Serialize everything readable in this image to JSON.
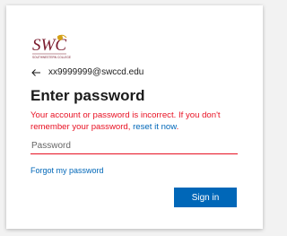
{
  "logo": {
    "name": "swc-logo",
    "text": "SWC",
    "subtext": "SOUTHWESTERN COLLEGE",
    "colors": {
      "primary": "#7b1c2e",
      "accent": "#d4a017"
    }
  },
  "identity": {
    "email": "xx9999999@swccd.edu",
    "back_icon": "arrow-left-icon"
  },
  "heading": "Enter password",
  "error": {
    "message": "Your account or password is incorrect. If you don't remember your password, ",
    "link": "reset it now",
    "suffix": "."
  },
  "password_field": {
    "placeholder": "Password",
    "value": ""
  },
  "forgot_link": "Forgot my password",
  "signin_button": "Sign in",
  "colors": {
    "error": "#e81123",
    "link": "#0067b8",
    "button_bg": "#0067b8",
    "button_text": "#ffffff",
    "page_bg": "#f2f2f2",
    "card_bg": "#ffffff"
  }
}
